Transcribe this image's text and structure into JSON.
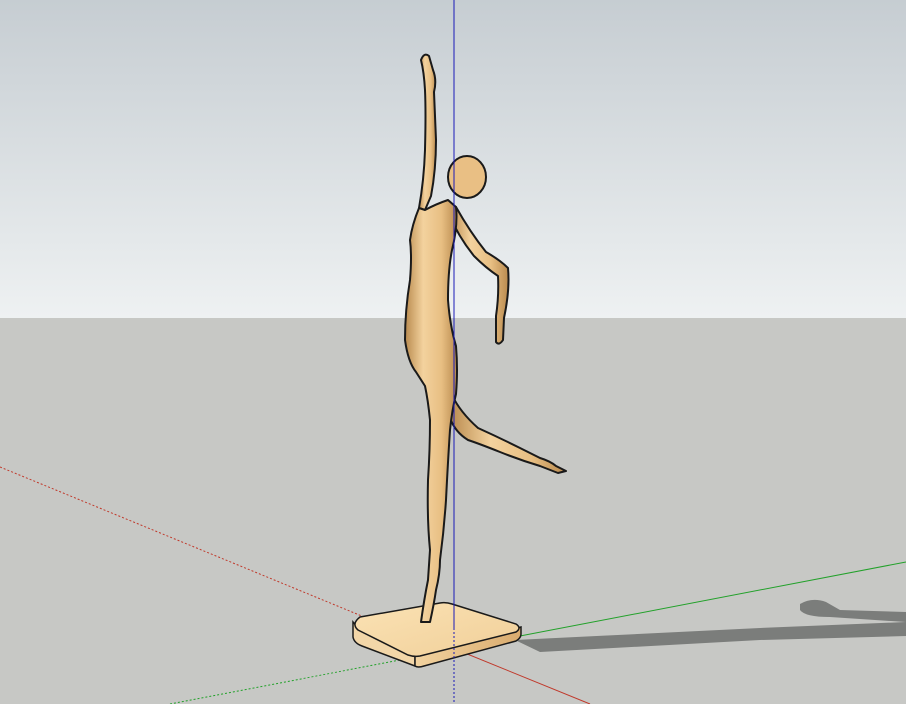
{
  "scene": {
    "colors": {
      "sky_top": "#c6cdd2",
      "sky_bottom": "#eef1f2",
      "ground": "#c7c8c5",
      "figure_light": "#f3d29e",
      "figure_mid": "#e3b575",
      "figure_dark": "#b98a4e",
      "outline": "#1a1a1a",
      "shadow": "#7b7d7b",
      "axis_red": "#c0392b",
      "axis_green": "#22a12a",
      "axis_blue": "#1a1ab8"
    },
    "icons": [
      "dancer-sculpture-model",
      "base-pedestal",
      "ground-shadow",
      "axis-red",
      "axis-green",
      "axis-blue"
    ]
  }
}
